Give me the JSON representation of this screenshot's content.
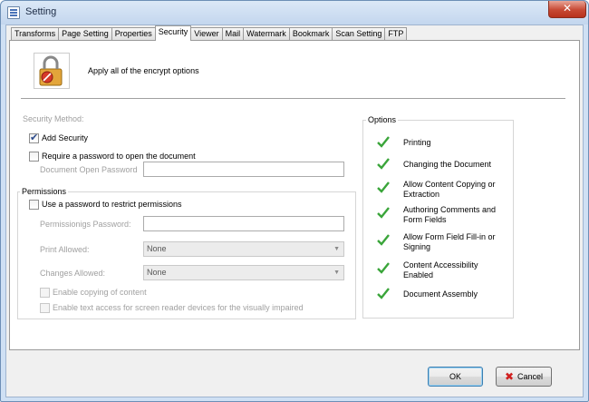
{
  "window": {
    "title": "Setting"
  },
  "tabs": [
    {
      "label": "Transforms",
      "active": false
    },
    {
      "label": "Page Setting",
      "active": false
    },
    {
      "label": "Properties",
      "active": false
    },
    {
      "label": "Security",
      "active": true
    },
    {
      "label": "Viewer",
      "active": false
    },
    {
      "label": "Mail",
      "active": false
    },
    {
      "label": "Watermark",
      "active": false
    },
    {
      "label": "Bookmark",
      "active": false
    },
    {
      "label": "Scan Setting",
      "active": false
    },
    {
      "label": "FTP",
      "active": false
    }
  ],
  "header": {
    "text": "Apply all of the encrypt options",
    "icon": "lock-icon"
  },
  "security_method": {
    "title": "Security Method:",
    "add_security": {
      "label": "Add Security",
      "checked": true
    },
    "require_open_password": {
      "label": "Require a password to open the document",
      "checked": false
    },
    "open_password_label": "Document Open Password",
    "open_password_value": ""
  },
  "permissions": {
    "title": "Permissions",
    "use_password": {
      "label": "Use a password to restrict permissions",
      "checked": false
    },
    "password_label": "Permissionigs Password:",
    "password_value": "",
    "print_allowed_label": "Print Allowed:",
    "print_allowed_value": "None",
    "changes_allowed_label": "Changes Allowed:",
    "changes_allowed_value": "None",
    "enable_copying": {
      "label": "Enable copying of content",
      "checked": false
    },
    "enable_text_access": {
      "label": "Enable text access for screen reader devices for the visually impaired",
      "checked": false
    }
  },
  "options": {
    "title": "Options",
    "items": [
      "Printing",
      "Changing the Document",
      "Allow Content Copying or Extraction",
      "Authoring Comments and Form Fields",
      "Allow Form Field Fill-in or Signing",
      "Content Accessibility Enabled",
      "Document Assembly"
    ],
    "check_color": "#3aa53a"
  },
  "buttons": {
    "ok": "OK",
    "cancel": "Cancel"
  },
  "colors": {
    "accent": "#3c7fb1",
    "close": "#c74934"
  }
}
